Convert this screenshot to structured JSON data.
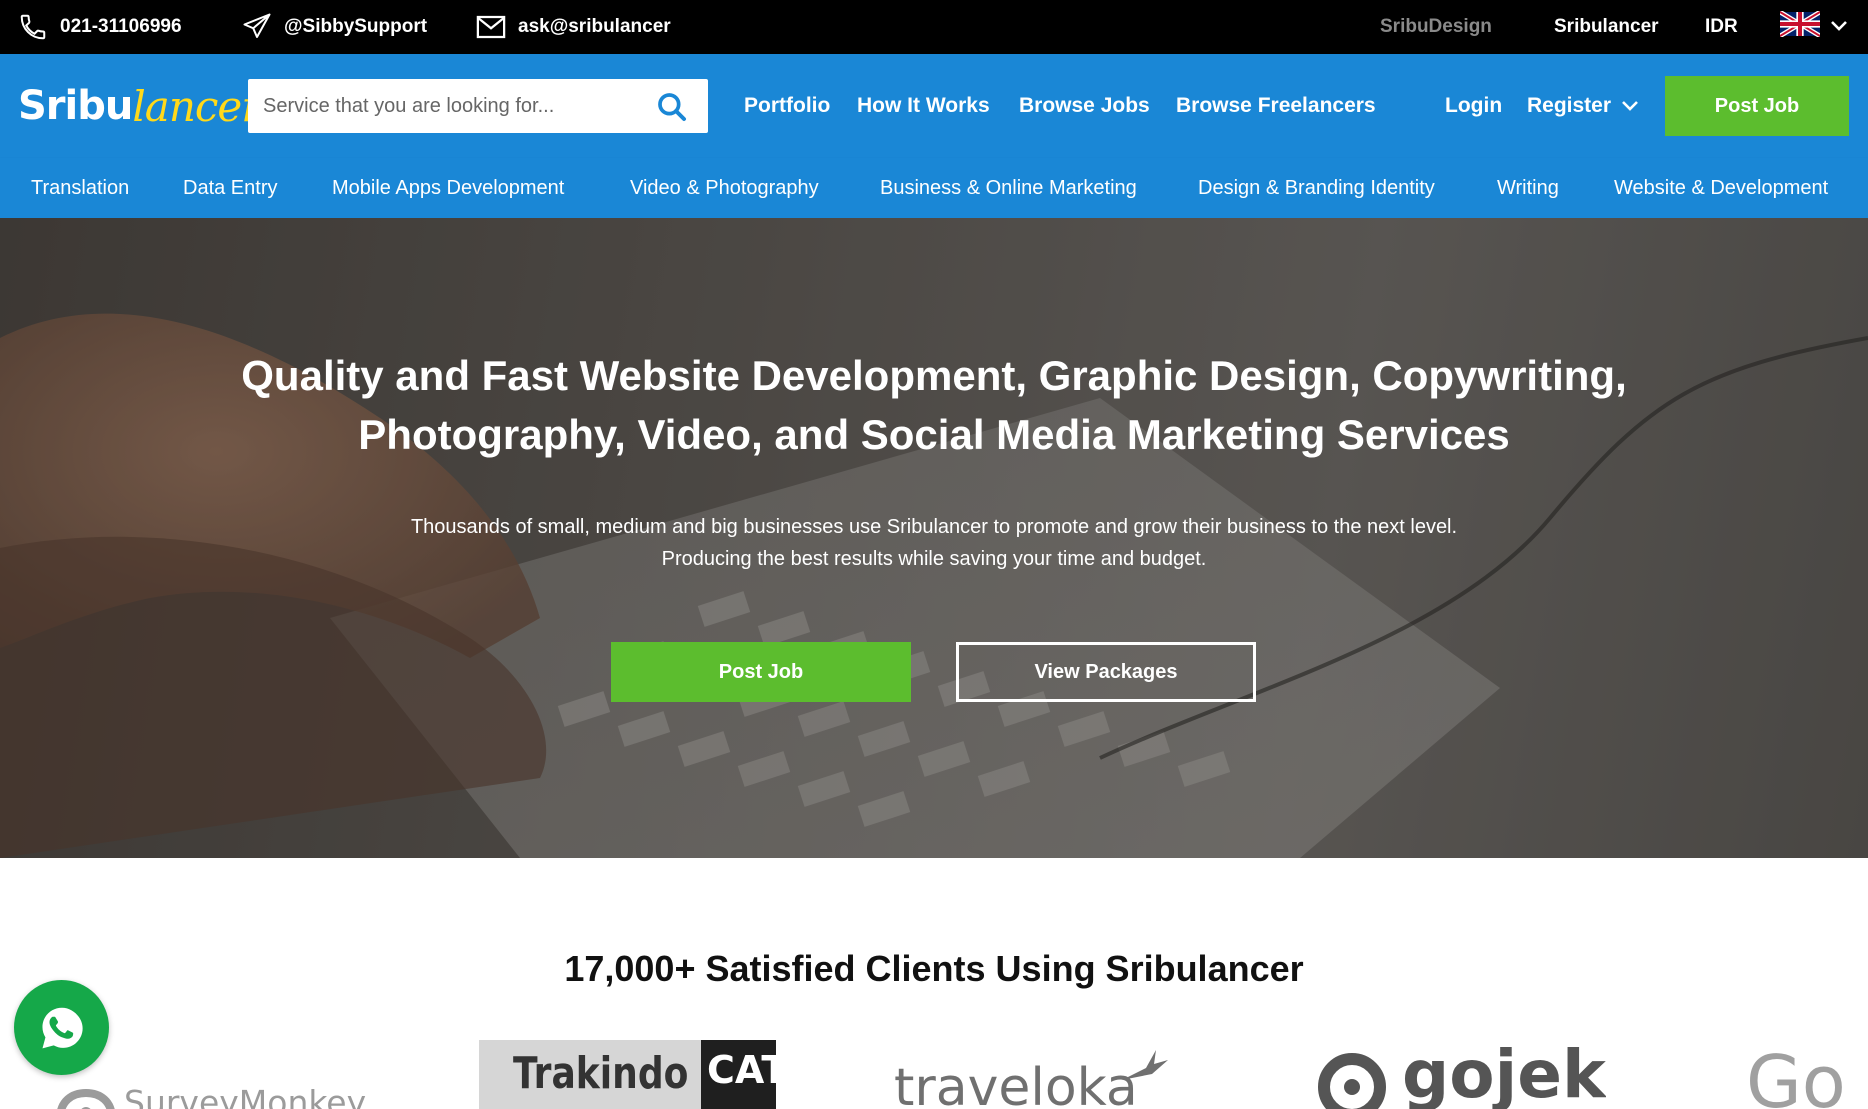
{
  "topbar": {
    "phone": "021-31106996",
    "support_handle": "@SibbySupport",
    "email": "ask@sribulancer",
    "sribudesign": "SribuDesign",
    "sribulancer": "Sribulancer",
    "currency": "IDR",
    "language_flag": "uk-flag-icon"
  },
  "logo": {
    "part1": "Sribu",
    "part2": "lancer"
  },
  "search": {
    "placeholder": "Service that you are looking for..."
  },
  "nav": {
    "portfolio": "Portfolio",
    "how_it_works": "How It Works",
    "browse_jobs": "Browse Jobs",
    "browse_freelancers": "Browse Freelancers",
    "login": "Login",
    "register": "Register",
    "post_job": "Post Job"
  },
  "categories": [
    "Translation",
    "Data Entry",
    "Mobile Apps Development",
    "Video & Photography",
    "Business & Online Marketing",
    "Design & Branding Identity",
    "Writing",
    "Website & Development"
  ],
  "hero": {
    "headline_line1": "Quality and Fast Website Development, Graphic Design, Copywriting,",
    "headline_line2": "Photography, Video, and Social Media Marketing Services",
    "sub_line1": "Thousands of small, medium and big businesses use Sribulancer to promote and grow their business to the next level.",
    "sub_line2": "Producing the best results while saving your time and budget.",
    "post_job": "Post Job",
    "view_packages": "View Packages"
  },
  "clients": {
    "title": "17,000+ Satisfied Clients Using Sribulancer",
    "logos": [
      "SurveyMonkey",
      "Trakindo",
      "CAT",
      "traveloka",
      "gojek",
      "Go"
    ]
  },
  "colors": {
    "brand_blue": "#1a87d6",
    "accent_green": "#5cbd2e",
    "logo_yellow": "#ffd91a",
    "whatsapp_green": "#15a849"
  }
}
